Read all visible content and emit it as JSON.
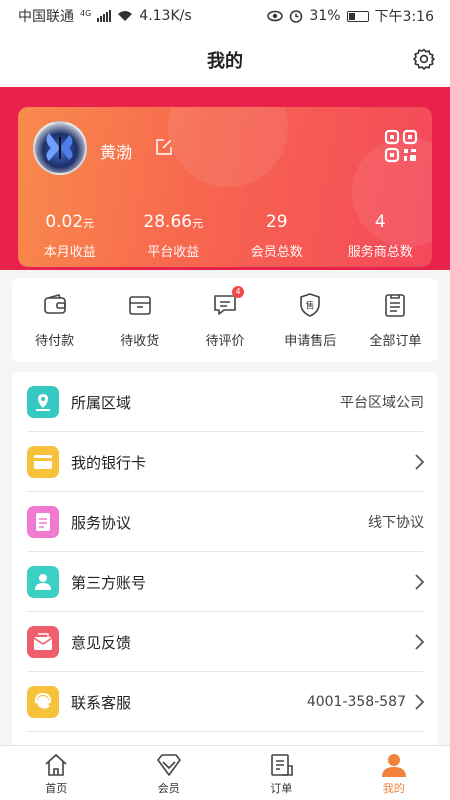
{
  "status": {
    "carrier": "中国联通",
    "net_badge": "4G",
    "speed": "4.13K/s",
    "battery": "31%",
    "time": "下午3:16"
  },
  "header": {
    "title": "我的"
  },
  "profile": {
    "name": "黄渤"
  },
  "stats": [
    {
      "value": "0.02",
      "unit": "元",
      "label": "本月收益"
    },
    {
      "value": "28.66",
      "unit": "元",
      "label": "平台收益"
    },
    {
      "value": "29",
      "unit": "",
      "label": "会员总数"
    },
    {
      "value": "4",
      "unit": "",
      "label": "服务商总数"
    }
  ],
  "orders": [
    {
      "label": "待付款",
      "icon": "wallet-icon"
    },
    {
      "label": "待收货",
      "icon": "box-icon"
    },
    {
      "label": "待评价",
      "icon": "comment-icon",
      "badge": "4"
    },
    {
      "label": "申请售后",
      "icon": "aftersale-icon"
    },
    {
      "label": "全部订单",
      "icon": "orders-list-icon"
    }
  ],
  "menu": [
    {
      "label": "所属区域",
      "value": "平台区域公司",
      "icon": "location-icon",
      "color": "#35c9c2",
      "arrow": false
    },
    {
      "label": "我的银行卡",
      "value": "",
      "icon": "bank-card-icon",
      "color": "#f6c23c",
      "arrow": true
    },
    {
      "label": "服务协议",
      "value": "线下协议",
      "icon": "agreement-icon",
      "color": "#f07ad0",
      "arrow": false
    },
    {
      "label": "第三方账号",
      "value": "",
      "icon": "account-icon",
      "color": "#3ccfc4",
      "arrow": true
    },
    {
      "label": "意见反馈",
      "value": "",
      "icon": "feedback-icon",
      "color": "#f0606c",
      "arrow": true
    },
    {
      "label": "联系客服",
      "value": "4001-358-587",
      "icon": "customer-service-icon",
      "color": "#f6c23c",
      "arrow": true
    }
  ],
  "tabs": [
    {
      "label": "首页",
      "icon": "home-icon"
    },
    {
      "label": "会员",
      "icon": "member-icon"
    },
    {
      "label": "订单",
      "icon": "order-icon"
    },
    {
      "label": "我的",
      "icon": "profile-icon",
      "active": true
    }
  ],
  "colors": {
    "accent": "#e8224a",
    "tab_active": "#f0823a"
  }
}
